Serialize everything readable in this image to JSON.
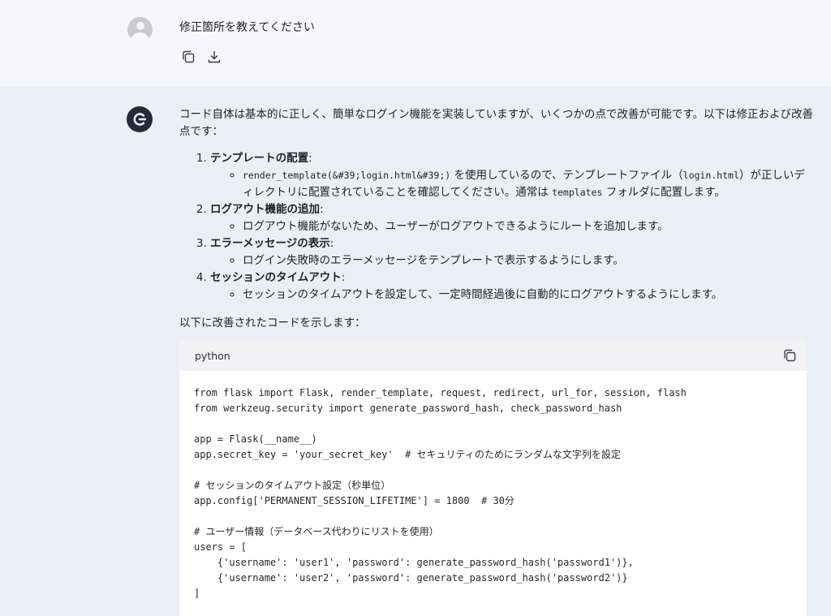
{
  "user_message": {
    "text": "修正箇所を教えてください",
    "actions": [
      "copy-icon",
      "download-icon"
    ]
  },
  "assistant": {
    "intro": "コード自体は基本的に正しく、簡単なログイン機能を実装していますが、いくつかの点で改善が可能です。以下は修正および改善点です：",
    "items": [
      {
        "title": "テンプレートの配置",
        "sub_prefix": "",
        "sub_code": "render_template(&#39;login.html&#39;)",
        "sub_mid": " を使用しているので、テンプレートファイル（",
        "sub_code2": "login.html",
        "sub_mid2": "）が正しいディレクトリに配置されていることを確認してください。通常は ",
        "sub_code3": "templates",
        "sub_suffix": " フォルダに配置します。"
      },
      {
        "title": "ログアウト機能の追加",
        "sub": "ログアウト機能がないため、ユーザーがログアウトできるようにルートを追加します。"
      },
      {
        "title": "エラーメッセージの表示",
        "sub": "ログイン失敗時のエラーメッセージをテンプレートで表示するようにします。"
      },
      {
        "title": "セッションのタイムアウト",
        "sub": "セッションのタイムアウトを設定して、一定時間経過後に自動的にログアウトするようにします。"
      }
    ],
    "outro": "以下に改善されたコードを示します：",
    "code_block": {
      "language": "python",
      "lines": [
        "from flask import Flask, render_template, request, redirect, url_for, session, flash",
        "from werkzeug.security import generate_password_hash, check_password_hash",
        "",
        "app = Flask(__name__)",
        "app.secret_key = 'your_secret_key'  # セキュリティのためにランダムな文字列を設定",
        "",
        "# セッションのタイムアウト設定（秒単位）",
        "app.config['PERMANENT_SESSION_LIFETIME'] = 1800  # 30分",
        "",
        "# ユーザー情報（データベース代わりにリストを使用）",
        "users = [",
        "    {'username': 'user1', 'password': generate_password_hash('password1')},",
        "    {'username': 'user2', 'password': generate_password_hash('password2')}",
        "]"
      ]
    }
  },
  "colors": {
    "page_bg": "#eceef6",
    "user_bg": "#f7f7f9",
    "logo_bg": "#252a3d",
    "code_bg": "#ffffff",
    "code_header_bg": "#f2f2f4"
  }
}
